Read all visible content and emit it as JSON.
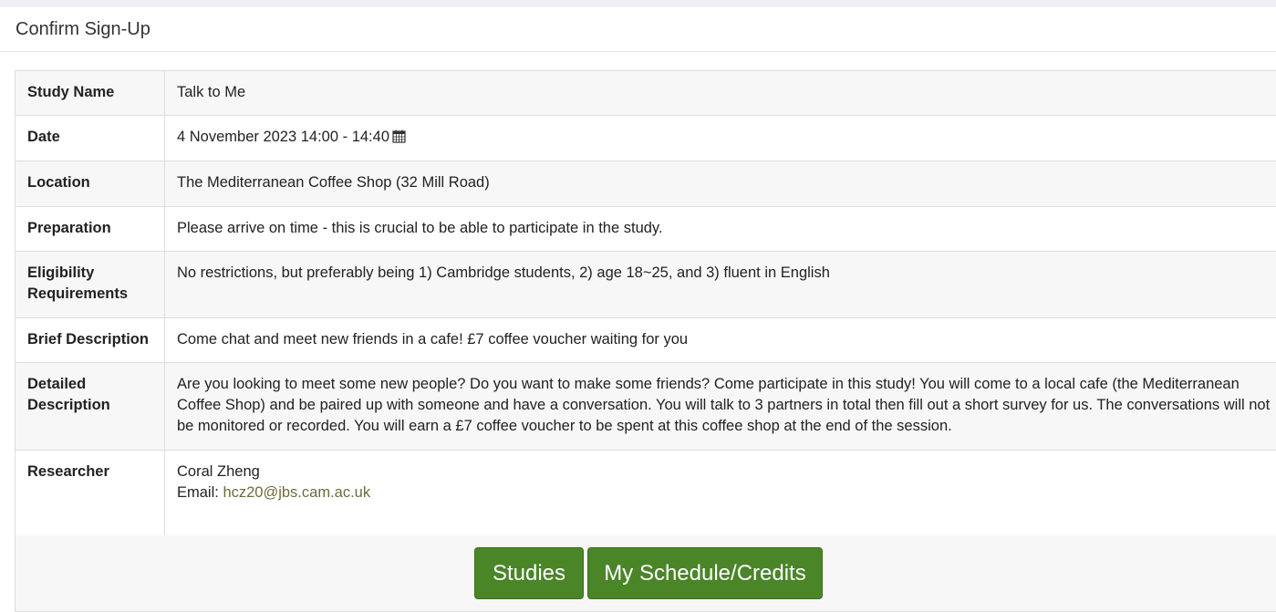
{
  "page": {
    "title": "Confirm Sign-Up"
  },
  "details": {
    "study_name": {
      "label": "Study Name",
      "value": "Talk to Me"
    },
    "date": {
      "label": "Date",
      "value": "4 November 2023 14:00 - 14:40",
      "icon": "calendar-icon"
    },
    "location": {
      "label": "Location",
      "value": "The Mediterranean Coffee Shop (32 Mill Road)"
    },
    "preparation": {
      "label": "Preparation",
      "value": "Please arrive on time - this is crucial to be able to participate in the study."
    },
    "eligibility": {
      "label": "Eligibility Requirements",
      "value": "No restrictions, but preferably being 1) Cambridge students, 2) age 18~25, and 3) fluent in English"
    },
    "brief_description": {
      "label": "Brief Description",
      "value": "Come chat and meet new friends in a cafe! £7 coffee voucher waiting for you"
    },
    "detailed_description": {
      "label": "Detailed Description",
      "value": "Are you looking to meet some new people? Do you want to make some friends? Come participate in this study! You will come to a local cafe (the Mediterranean Coffee Shop) and be paired up with someone and have a conversation. You will talk to 3 partners in total then fill out a short survey for us. The conversations will not be monitored or recorded. You will earn a £7 coffee voucher to be spent at this coffee shop at the end of the session."
    },
    "researcher": {
      "label": "Researcher",
      "name": "Coral Zheng",
      "email_label": "Email:",
      "email": "hcz20@jbs.cam.ac.uk"
    }
  },
  "actions": {
    "studies_label": "Studies",
    "schedule_label": "My Schedule/Credits"
  },
  "colors": {
    "button_bg": "#4a8528",
    "link": "#6b6b3a"
  }
}
